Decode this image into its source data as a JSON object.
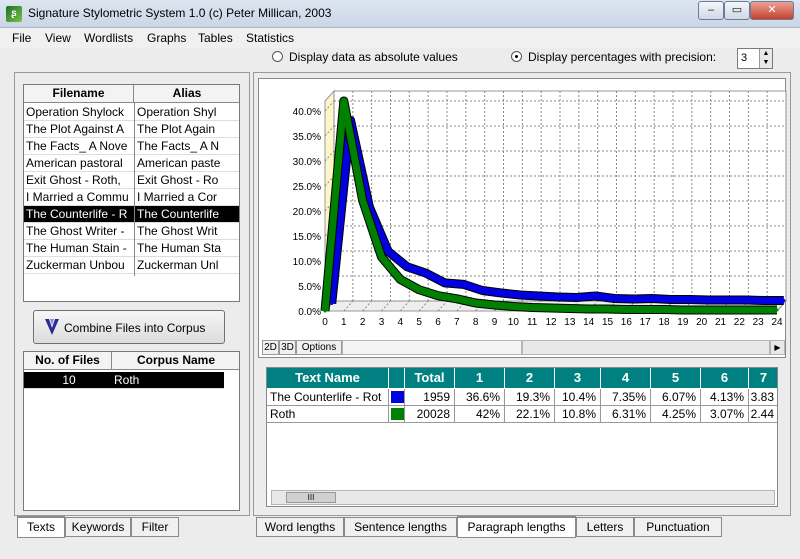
{
  "window": {
    "title": "Signature Stylometric System 1.0  (c) Peter Millican, 2003",
    "minimize": "‒",
    "restore": "▭",
    "close": "✕"
  },
  "menu": [
    "File",
    "View",
    "Wordlists",
    "Graphs",
    "Tables",
    "Statistics"
  ],
  "display_options": {
    "absolute_label": "Display data as absolute values",
    "percent_label": "Display percentages with precision:",
    "precision": "3",
    "selected": "percent"
  },
  "files": {
    "headers": [
      "Filename",
      "Alias"
    ],
    "rows": [
      {
        "filename": "Operation Shylock",
        "alias": "Operation Shyl"
      },
      {
        "filename": "The Plot Against A",
        "alias": "The Plot Again"
      },
      {
        "filename": "The Facts_ A Nove",
        "alias": "The Facts_ A N"
      },
      {
        "filename": "American pastoral",
        "alias": "American paste"
      },
      {
        "filename": "Exit Ghost - Roth,",
        "alias": "Exit Ghost - Ro"
      },
      {
        "filename": "I Married a Commu",
        "alias": "I Married a Cor"
      },
      {
        "filename": "The Counterlife - R",
        "alias": "The Counterlife",
        "selected": true
      },
      {
        "filename": "The Ghost Writer -",
        "alias": "The Ghost Writ"
      },
      {
        "filename": "The Human Stain -",
        "alias": "The Human Sta"
      },
      {
        "filename": "Zuckerman Unbou",
        "alias": "Zuckerman Unl"
      }
    ]
  },
  "combine_button": "Combine Files into Corpus",
  "corpus": {
    "headers": [
      "No. of Files",
      "Corpus Name"
    ],
    "rows": [
      {
        "count": "10",
        "name": "Roth"
      }
    ]
  },
  "left_tabs": [
    "Texts",
    "Keywords",
    "Filter"
  ],
  "chart_view_tabs": [
    "2D",
    "3D",
    "Options"
  ],
  "bottom_tabs": [
    "Word lengths",
    "Sentence lengths",
    "Paragraph lengths",
    "Letters",
    "Punctuation"
  ],
  "active_bottom_tab": "Paragraph lengths",
  "chart_data": {
    "type": "line",
    "x": [
      0,
      1,
      2,
      3,
      4,
      5,
      6,
      7,
      8,
      9,
      10,
      11,
      12,
      13,
      14,
      15,
      16,
      17,
      18,
      19,
      20,
      21,
      22,
      23,
      24
    ],
    "xticks": [
      "0",
      "1",
      "2",
      "3",
      "4",
      "5",
      "6",
      "7",
      "8",
      "9",
      "10",
      "11",
      "12",
      "13",
      "14",
      "15",
      "16",
      "17",
      "18",
      "19",
      "20",
      "21",
      "22",
      "23",
      "24"
    ],
    "yticks": [
      "0.0%",
      "5.0%",
      "10.0%",
      "15.0%",
      "20.0%",
      "25.0%",
      "30.0%",
      "35.0%",
      "40.0%"
    ],
    "ylim": [
      0,
      42
    ],
    "series": [
      {
        "color": "#0000e0",
        "values": [
          0,
          36.6,
          19.3,
          10.4,
          7.35,
          6.07,
          4.13,
          3.83,
          2.6,
          2.1,
          1.7,
          1.5,
          1.3,
          1.2,
          1.5,
          1.0,
          0.9,
          1.0,
          0.8,
          0.8,
          0.7,
          0.7,
          0.7,
          0.6,
          0.6
        ]
      },
      {
        "color": "#008000",
        "values": [
          0,
          42,
          22.1,
          10.8,
          6.31,
          4.25,
          3.07,
          2.44,
          1.6,
          1.2,
          0.9,
          0.7,
          0.6,
          0.5,
          0.4,
          0.4,
          0.3,
          0.3,
          0.3,
          0.2,
          0.2,
          0.2,
          0.2,
          0.2,
          0.2
        ]
      }
    ]
  },
  "table": {
    "headers": [
      "Text Name",
      "",
      "Total",
      "1",
      "2",
      "3",
      "4",
      "5",
      "6",
      "7"
    ],
    "rows": [
      {
        "name": "The Counterlife - Rot",
        "color": "#0000e0",
        "values": [
          "1959",
          "36.6%",
          "19.3%",
          "10.4%",
          "7.35%",
          "6.07%",
          "4.13%",
          "3.83"
        ]
      },
      {
        "name": "Roth",
        "color": "#008000",
        "values": [
          "20028",
          "42%",
          "22.1%",
          "10.8%",
          "6.31%",
          "4.25%",
          "3.07%",
          "2.44"
        ]
      }
    ],
    "scroll_grip": "III"
  }
}
